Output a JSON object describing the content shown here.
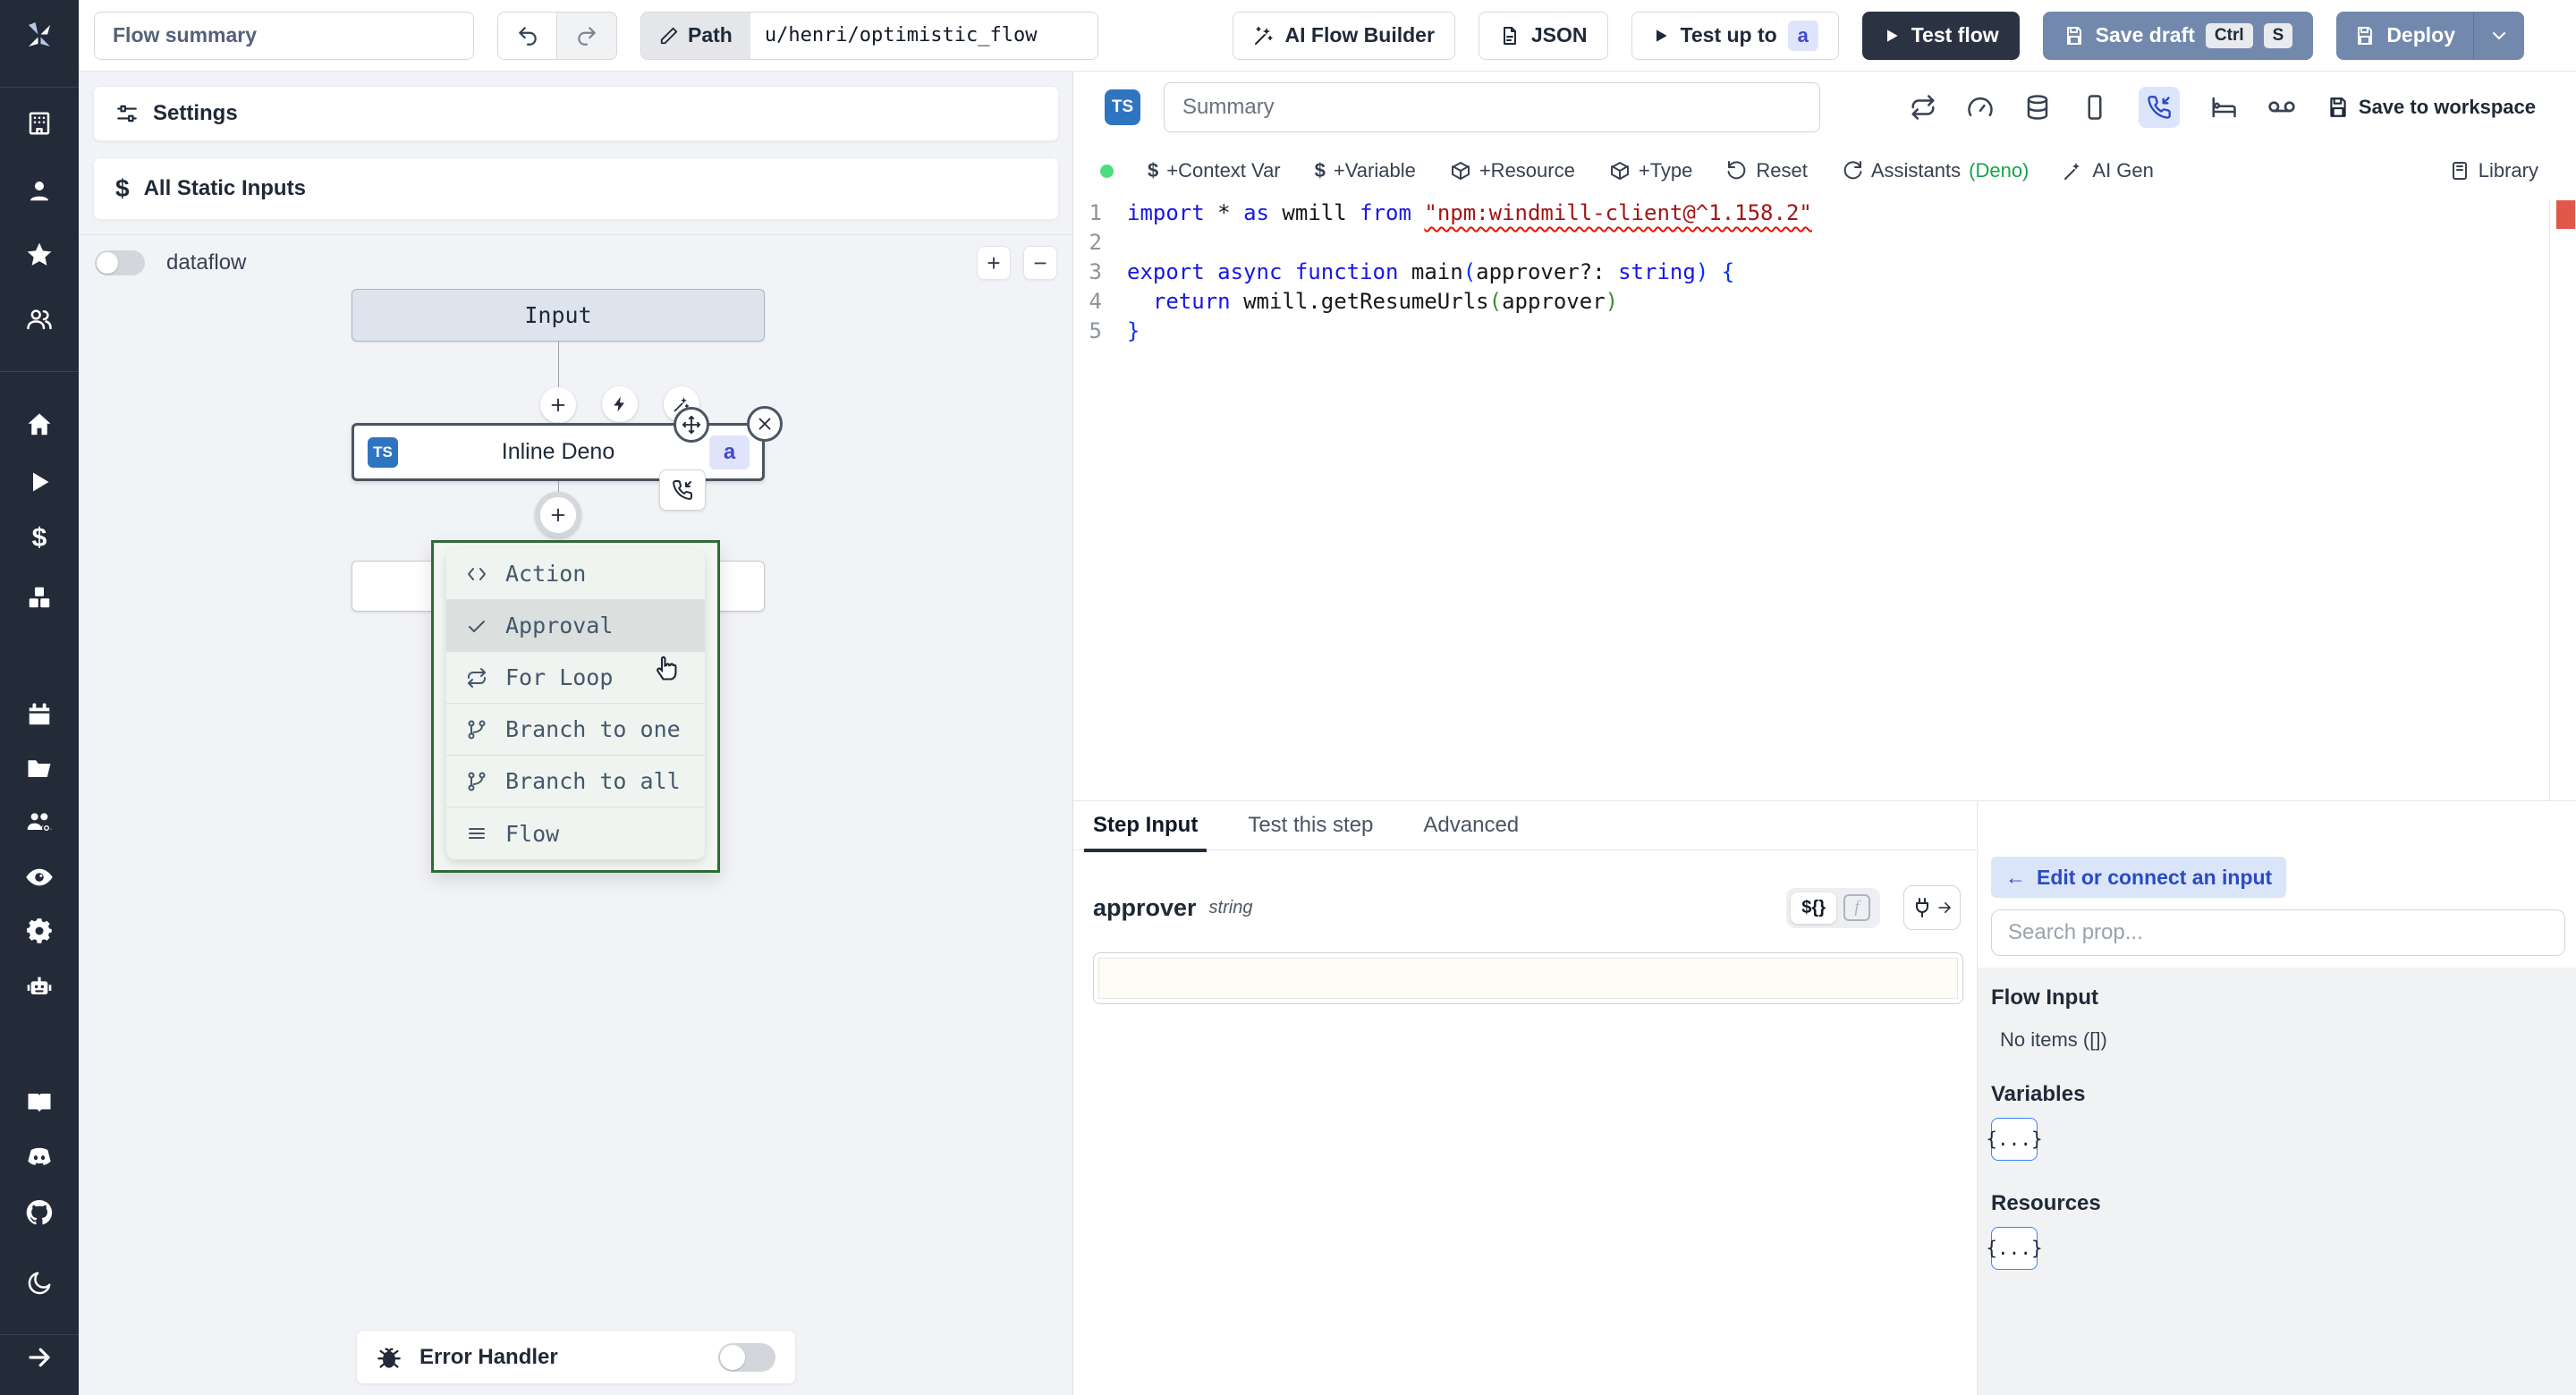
{
  "top_bar": {
    "flow_summary_placeholder": "Flow summary",
    "path_label": "Path",
    "path_value": "u/henri/optimistic_flow",
    "ai_flow_builder_label": "AI Flow Builder",
    "json_label": "JSON",
    "test_up_to_label": "Test up to",
    "test_up_to_badge": "a",
    "test_flow_label": "Test flow",
    "save_draft_label": "Save draft",
    "save_draft_kbd_1": "Ctrl",
    "save_draft_kbd_2": "S",
    "deploy_label": "Deploy"
  },
  "flow_panel": {
    "settings_label": "Settings",
    "all_static_inputs_label": "All Static Inputs",
    "dataflow_label": "dataflow",
    "input_node_label": "Input",
    "step_node_label": "Inline Deno",
    "step_node_lang": "TS",
    "step_node_badge": "a",
    "menu": {
      "items": [
        {
          "label": "Action"
        },
        {
          "label": "Approval"
        },
        {
          "label": "For Loop"
        },
        {
          "label": "Branch to one"
        },
        {
          "label": "Branch to all"
        },
        {
          "label": "Flow"
        }
      ]
    },
    "error_handler_label": "Error Handler"
  },
  "editor": {
    "lang_badge": "TS",
    "summary_placeholder": "Summary",
    "save_to_workspace_label": "Save to workspace",
    "actions": {
      "context_var": "+Context Var",
      "variable": "+Variable",
      "resource": "+Resource",
      "type": "+Type",
      "reset": "Reset",
      "assistants": "Assistants",
      "assistants_lang": "(Deno)",
      "ai_gen": "AI Gen",
      "library": "Library"
    },
    "code": {
      "lines": [
        {
          "no": "1",
          "tokens": [
            [
              "kw",
              "import "
            ],
            [
              "p",
              "* "
            ],
            [
              "kw",
              "as "
            ],
            [
              "p",
              "wmill "
            ],
            [
              "kw",
              "from "
            ],
            [
              "str-err",
              "\"npm:windmill-client@^1.158.2\""
            ]
          ]
        },
        {
          "no": "2",
          "tokens": []
        },
        {
          "no": "3",
          "tokens": [
            [
              "kw",
              "export "
            ],
            [
              "kw",
              "async "
            ],
            [
              "kw",
              "function "
            ],
            [
              "p",
              "main"
            ],
            [
              "pb",
              "("
            ],
            [
              "p",
              "approver?: "
            ],
            [
              "kw",
              "string"
            ],
            [
              "pb",
              ") {"
            ]
          ]
        },
        {
          "no": "4",
          "tokens": [
            [
              "p",
              "  "
            ],
            [
              "kw",
              "return "
            ],
            [
              "p",
              "wmill.getResumeUrls"
            ],
            [
              "pg",
              "("
            ],
            [
              "p",
              "approver"
            ],
            [
              "pg",
              ")"
            ]
          ]
        },
        {
          "no": "5",
          "tokens": [
            [
              "pb",
              "}"
            ]
          ]
        }
      ]
    }
  },
  "step_panel": {
    "tabs": [
      {
        "label": "Step Input"
      },
      {
        "label": "Test this step"
      },
      {
        "label": "Advanced"
      }
    ],
    "field_name": "approver",
    "field_type": "string"
  },
  "connect_panel": {
    "back_label": "Edit or connect an input",
    "search_placeholder": "Search prop...",
    "flow_input_title": "Flow Input",
    "flow_input_empty": "No items ([])",
    "variables_title": "Variables",
    "variables_chip": "{...}",
    "resources_title": "Resources",
    "resources_chip": "{...}"
  },
  "glyphs": {
    "dollar": "$",
    "plus": "+",
    "minus": "−",
    "back_arrow": "←",
    "expr": "${}",
    "fn": "f"
  },
  "colors": {
    "accent_blue": "#2f74c0",
    "badge_indigo_bg": "#e0e4fb",
    "badge_indigo_text": "#4347d1",
    "button_slate": "#7289ad",
    "button_dark": "#2b3342",
    "menu_green_border": "#2e6b34",
    "error_marker_red": "#e2574c",
    "assistant_dot_green": "#4ade80",
    "deno_green": "#16a34a"
  }
}
